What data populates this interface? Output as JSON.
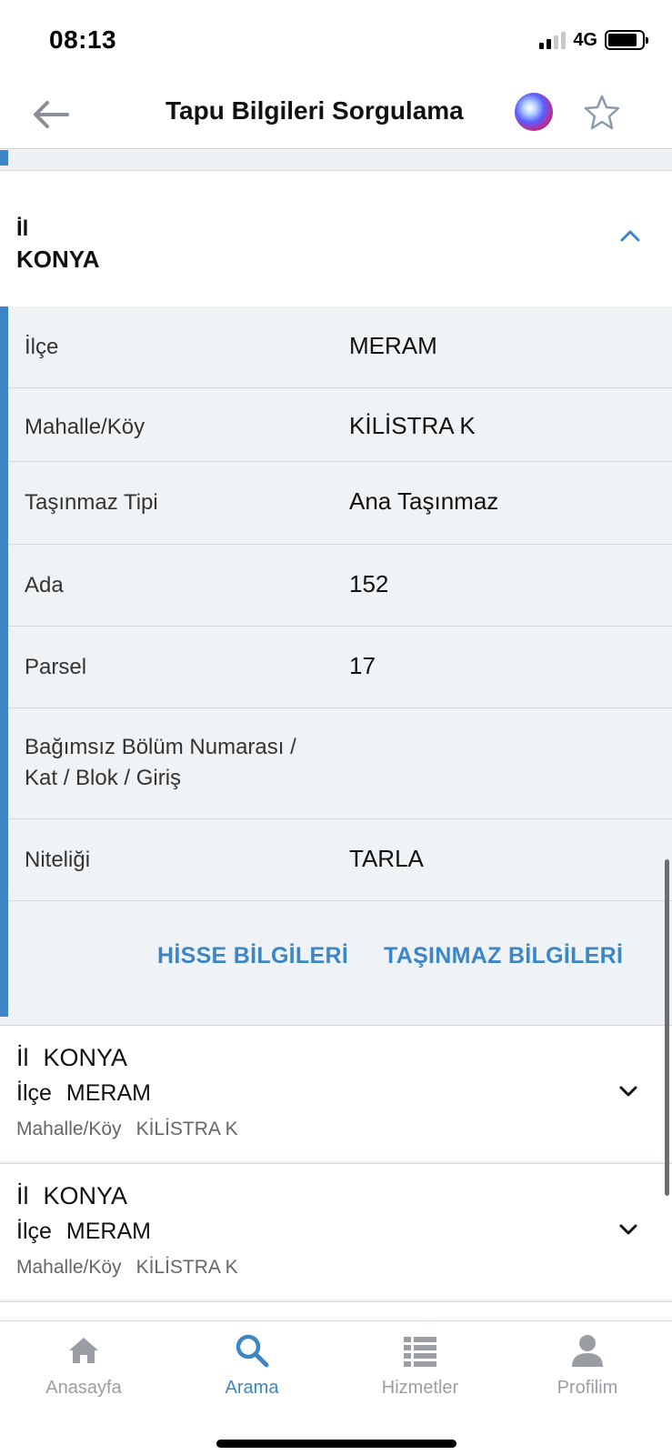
{
  "status": {
    "time": "08:13",
    "network": "4G"
  },
  "nav": {
    "title": "Tapu Bilgileri Sorgulama"
  },
  "expanded": {
    "label": "İl",
    "value": "KONYA",
    "rows": [
      {
        "key": "İlçe",
        "value": "MERAM"
      },
      {
        "key": "Mahalle/Köy",
        "value": "KİLİSTRA K"
      },
      {
        "key": "Taşınmaz Tipi",
        "value": "Ana Taşınmaz"
      },
      {
        "key": "Ada",
        "value": "152"
      },
      {
        "key": "Parsel",
        "value": "17"
      },
      {
        "key": "Bağımsız Bölüm Numarası / Kat / Blok / Giriş",
        "value": ""
      },
      {
        "key": "Niteliği",
        "value": "TARLA"
      }
    ],
    "actions": {
      "hisse": "HİSSE BİLGİLERİ",
      "tasinmaz": "TAŞINMAZ BİLGİLERİ"
    }
  },
  "records": [
    {
      "il_label": "İl",
      "il": "KONYA",
      "ilce_label": "İlçe",
      "ilce": "MERAM",
      "mahalle_label": "Mahalle/Köy",
      "mahalle": "KİLİSTRA K"
    },
    {
      "il_label": "İl",
      "il": "KONYA",
      "ilce_label": "İlçe",
      "ilce": "MERAM",
      "mahalle_label": "Mahalle/Köy",
      "mahalle": "KİLİSTRA K"
    }
  ],
  "tabs": [
    {
      "label": "Anasayfa",
      "icon": "home-icon"
    },
    {
      "label": "Arama",
      "icon": "search-icon",
      "active": true
    },
    {
      "label": "Hizmetler",
      "icon": "list-icon"
    },
    {
      "label": "Profilim",
      "icon": "person-icon"
    }
  ],
  "colors": {
    "accent": "#3d86c6",
    "inactive": "#9a9ea3"
  }
}
